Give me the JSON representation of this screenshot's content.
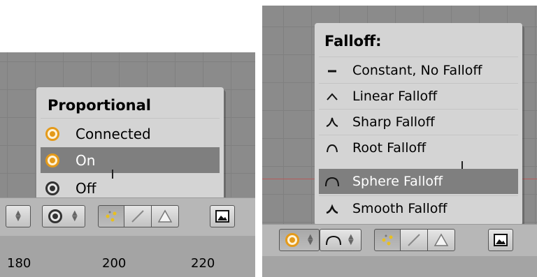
{
  "proportional_menu": {
    "title": "Proportional",
    "items": [
      {
        "label": "Connected",
        "icon": "proportional-connected-icon"
      },
      {
        "label": "On",
        "icon": "proportional-on-icon",
        "highlighted": true
      },
      {
        "label": "Off",
        "icon": "proportional-off-icon"
      }
    ]
  },
  "falloff_menu": {
    "title": "Falloff:",
    "items": [
      {
        "label": "Constant, No Falloff",
        "icon": "constant-falloff-icon"
      },
      {
        "label": "Linear Falloff",
        "icon": "linear-falloff-icon"
      },
      {
        "label": "Sharp Falloff",
        "icon": "sharp-falloff-icon"
      },
      {
        "label": "Root Falloff",
        "icon": "root-falloff-icon"
      },
      {
        "label": "Sphere Falloff",
        "icon": "sphere-falloff-icon",
        "highlighted": true
      },
      {
        "label": "Smooth Falloff",
        "icon": "smooth-falloff-icon"
      }
    ]
  },
  "left_timeline": {
    "ruler_labels": [
      "180",
      "200",
      "220"
    ]
  },
  "colors": {
    "highlight": "#7f7f7f",
    "menu_bg": "#d4d4d4",
    "viewport_bg": "#8b8b8b",
    "proportional_on": "#e49a1a",
    "axis_line": "#b65a5a"
  }
}
